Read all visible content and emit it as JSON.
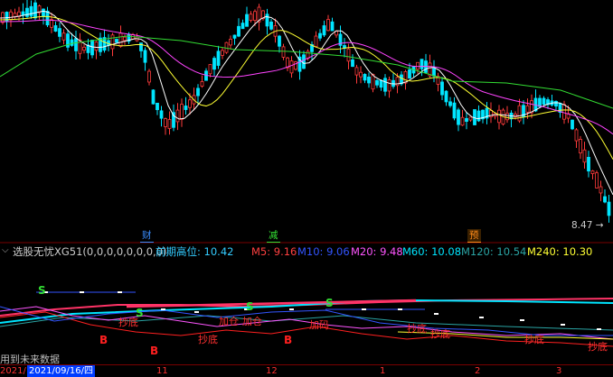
{
  "price_chart": {
    "last_price_label": "8.47",
    "event_markers": [
      {
        "label": "财",
        "color": "#3a8dff"
      },
      {
        "label": "减",
        "color": "#33dd33"
      },
      {
        "label": "预",
        "color": "#ff8c1a"
      }
    ],
    "colors": {
      "up": "#ff3b3b",
      "down": "#00e5ff",
      "ma5": "#ffffff",
      "ma10": "#ffff33",
      "ma20": "#ff44ff",
      "ma60": "#33dd33"
    }
  },
  "indicator": {
    "toggle_icon": "chevron-down-icon",
    "name": "选股无忧XG51(0,0,0,0,0,0,0,0)",
    "prior_high_label": "前期高位: 10.42",
    "ma_values": [
      {
        "label": "M5: 9.16",
        "color": "#ff4040"
      },
      {
        "label": "M10: 9.06",
        "color": "#3355ff"
      },
      {
        "label": "M20: 9.48",
        "color": "#ff55ff"
      },
      {
        "label": "M60: 10.08",
        "color": "#00e5ff"
      },
      {
        "label": "M120: 10.54",
        "color": "#2aa4a4"
      },
      {
        "label": "M240: 10.30",
        "color": "#ffff33"
      }
    ]
  },
  "signals": {
    "s_label": "S",
    "b_label": "B",
    "chaodi_label": "抄底",
    "jiacang_label": "加仓",
    "jiacang2_label": "加仓",
    "jiama_label": "加码"
  },
  "bottom": {
    "notice": "用到未来数据",
    "date_prefix": "2021/",
    "date_selected": "2021/09/16/四",
    "ticks": [
      "11",
      "12",
      "1",
      "2",
      "3"
    ]
  }
}
